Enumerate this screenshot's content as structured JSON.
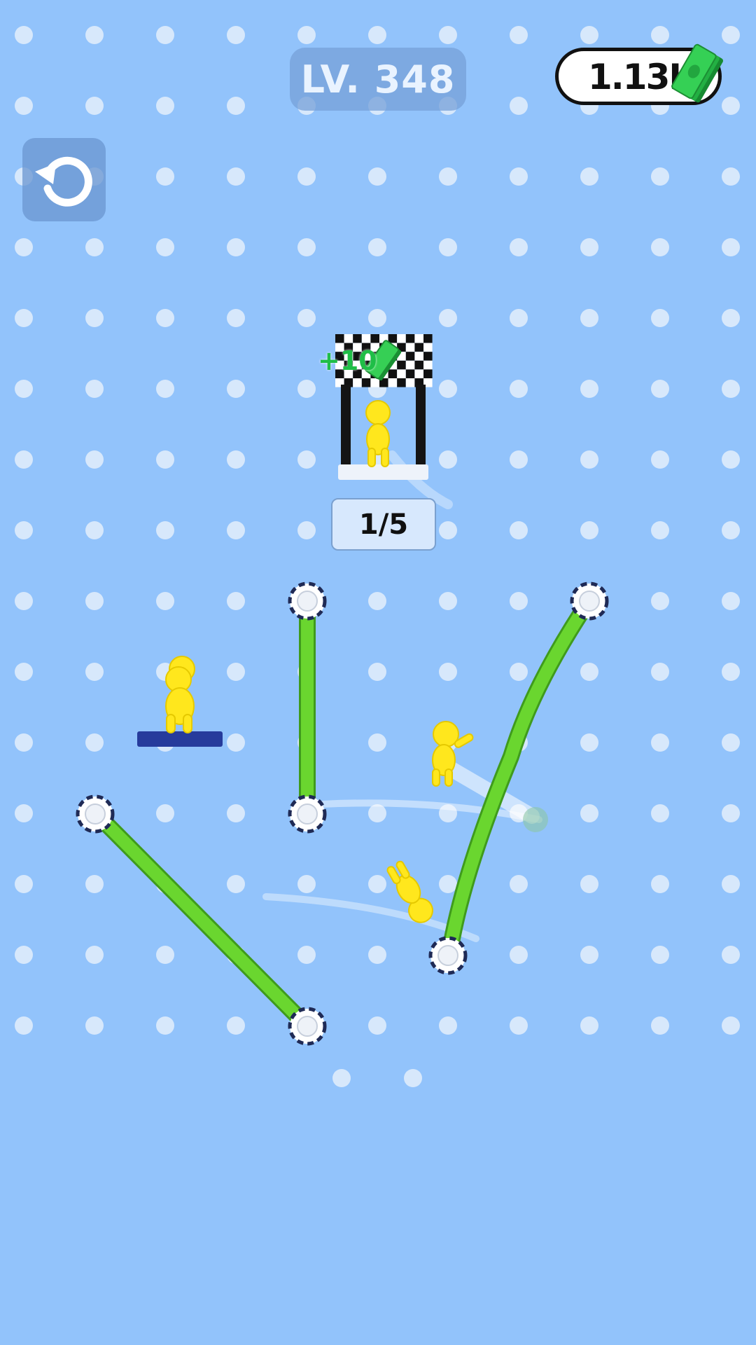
{
  "hud": {
    "level_label": "LV. 348",
    "money_label": "1.13K",
    "restart_icon": "restart-icon",
    "money_icon": "cash-stack-icon"
  },
  "finish": {
    "reward_label": "+10",
    "reward_icon": "cash-stack-icon",
    "counter_label": "1/5"
  },
  "scene": {
    "rope_color": "#6ad62f",
    "figure_color": "#ffe71d",
    "platform_color": "#263b9c",
    "background_color": "#92c3fb",
    "dot_color": "#d7e8fb"
  }
}
